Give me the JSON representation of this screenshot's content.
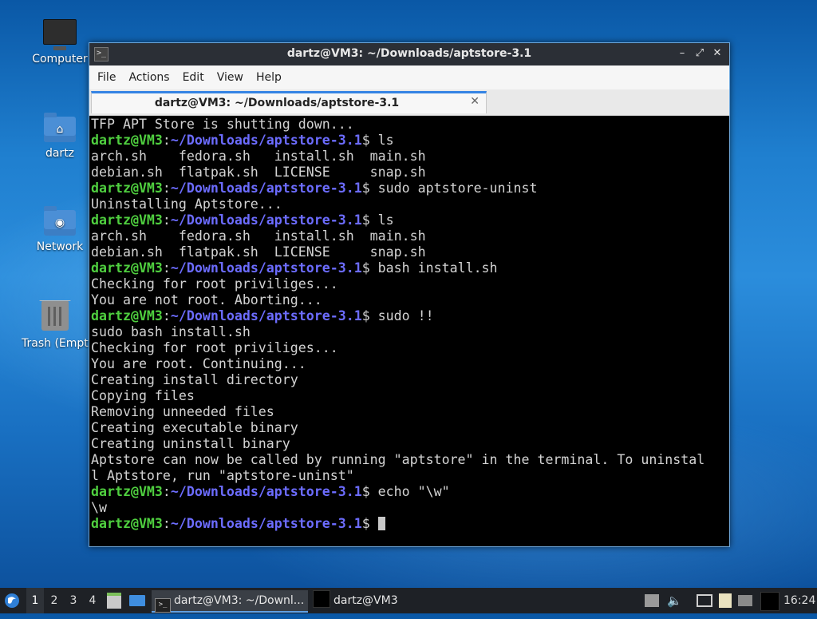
{
  "desktop": {
    "icons": [
      {
        "label": "Computer"
      },
      {
        "label": "dartz"
      },
      {
        "label": "Network"
      },
      {
        "label": "Trash (Empt"
      }
    ]
  },
  "window": {
    "title": "dartz@VM3: ~/Downloads/aptstore-3.1",
    "controls": {
      "minimize": "–",
      "maximize": "⤢",
      "close": "✕"
    },
    "menu": [
      "File",
      "Actions",
      "Edit",
      "View",
      "Help"
    ],
    "tab": {
      "label": "dartz@VM3: ~/Downloads/aptstore-3.1",
      "close": "✕"
    }
  },
  "terminal": {
    "user": "dartz@VM3",
    "path": "~/Downloads/aptstore-3.1",
    "lines": [
      {
        "text": "TFP APT Store is shutting down..."
      },
      {
        "cmd": "ls"
      },
      {
        "text": "arch.sh    fedora.sh   install.sh  main.sh"
      },
      {
        "text": "debian.sh  flatpak.sh  LICENSE     snap.sh"
      },
      {
        "cmd": "sudo aptstore-uninst"
      },
      {
        "text": "Uninstalling Aptstore..."
      },
      {
        "cmd": "ls"
      },
      {
        "text": "arch.sh    fedora.sh   install.sh  main.sh"
      },
      {
        "text": "debian.sh  flatpak.sh  LICENSE     snap.sh"
      },
      {
        "cmd": "bash install.sh"
      },
      {
        "text": "Checking for root priviliges..."
      },
      {
        "text": "You are not root. Aborting..."
      },
      {
        "cmd": "sudo !!"
      },
      {
        "text": "sudo bash install.sh"
      },
      {
        "text": "Checking for root priviliges..."
      },
      {
        "text": "You are root. Continuing..."
      },
      {
        "text": "Creating install directory"
      },
      {
        "text": "Copying files"
      },
      {
        "text": "Removing unneeded files"
      },
      {
        "text": "Creating executable binary"
      },
      {
        "text": "Creating uninstall binary"
      },
      {
        "text": "Aptstore can now be called by running \"aptstore\" in the terminal. To uninstal"
      },
      {
        "text": "l Aptstore, run \"aptstore-uninst\""
      },
      {
        "cmd": "echo \"\\w\""
      },
      {
        "text": "\\w"
      },
      {
        "cmd": "",
        "cursor": true
      }
    ]
  },
  "taskbar": {
    "workspaces": [
      "1",
      "2",
      "3",
      "4"
    ],
    "active_workspace": "1",
    "tasks": [
      {
        "label": "dartz@VM3: ~/Downl...",
        "active": true
      },
      {
        "label": "dartz@VM3",
        "active": false
      }
    ],
    "clock": "16:24"
  },
  "colors": {
    "prompt_user": "#4fcf3f",
    "prompt_path": "#6c6cff",
    "accent": "#3584e4"
  }
}
